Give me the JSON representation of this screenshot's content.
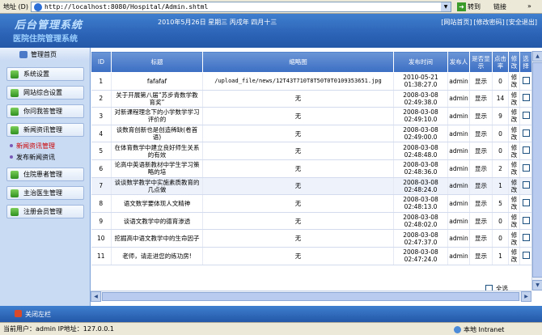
{
  "browser": {
    "address_label": "地址 (D)",
    "url": "http://localhost:8080/Hospital/Admin.shtml",
    "go_label": "转到",
    "links_label": "链接"
  },
  "header": {
    "logo": "后台管理系统",
    "system_name": "医院住院管理系统",
    "date": "2010年5月26日 星期三 丙戌年 四月十三",
    "links": [
      "[网站首页]",
      "[修改密码]",
      "[安全退出]"
    ]
  },
  "sidebar": {
    "title": "管理首页",
    "items": [
      {
        "label": "系统设置"
      },
      {
        "label": "网站综合设置"
      },
      {
        "label": "你问我答管理"
      },
      {
        "label": "新闻资讯管理"
      }
    ],
    "subitems": [
      {
        "label": "新闻资讯管理",
        "active": true
      },
      {
        "label": "发布新闻资讯",
        "active": false
      }
    ],
    "items2": [
      {
        "label": "住院患者管理"
      },
      {
        "label": "主治医生管理"
      },
      {
        "label": "注册会员管理"
      }
    ]
  },
  "table": {
    "headers": [
      "ID",
      "标题",
      "缩略图",
      "发布时间",
      "发布人",
      "是否显示",
      "点击率",
      "修改",
      "选择"
    ],
    "rows": [
      {
        "id": "1",
        "title": "fafafaf",
        "thumb": "/upload_file/news/12T43T710T8T50T0T0109353651.jpg",
        "time": "2010-05-21 01:38:27.0",
        "author": "admin",
        "show": "显示",
        "clicks": "0",
        "edit": "修改"
      },
      {
        "id": "2",
        "title": "关于开展第八届“苏步青数学教育奖”",
        "thumb": "无",
        "time": "2008-03-08 02:49:38.0",
        "author": "admin",
        "show": "显示",
        "clicks": "14",
        "edit": "修改"
      },
      {
        "id": "3",
        "title": "对新课程理念下的小学数学学习评价的",
        "thumb": "无",
        "time": "2008-03-08 02:49:10.0",
        "author": "admin",
        "show": "显示",
        "clicks": "9",
        "edit": "修改"
      },
      {
        "id": "4",
        "title": "谈数育创新也是创造稀缺(卷首语)",
        "thumb": "无",
        "time": "2008-03-08 02:49:00.0",
        "author": "admin",
        "show": "显示",
        "clicks": "0",
        "edit": "修改"
      },
      {
        "id": "5",
        "title": "在体育数学中建立良好师生关系的有效",
        "thumb": "无",
        "time": "2008-03-08 02:48:48.0",
        "author": "admin",
        "show": "显示",
        "clicks": "0",
        "edit": "修改"
      },
      {
        "id": "6",
        "title": "论高中英语新教材中学生学习策略的培",
        "thumb": "无",
        "time": "2008-03-08 02:48:36.0",
        "author": "admin",
        "show": "显示",
        "clicks": "2",
        "edit": "修改"
      },
      {
        "id": "7",
        "title": "谈谈数学教学中实施素质教育的几点做",
        "thumb": "无",
        "time": "2008-03-08 02:48:24.0",
        "author": "admin",
        "show": "显示",
        "clicks": "1",
        "edit": "修改"
      },
      {
        "id": "8",
        "title": "语文数学要体现人文精神",
        "thumb": "无",
        "time": "2008-03-08 02:48:13.0",
        "author": "admin",
        "show": "显示",
        "clicks": "5",
        "edit": "修改"
      },
      {
        "id": "9",
        "title": "谈语文教学中的德育渗透",
        "thumb": "无",
        "time": "2008-03-08 02:48:02.0",
        "author": "admin",
        "show": "显示",
        "clicks": "0",
        "edit": "修改"
      },
      {
        "id": "10",
        "title": "挖掘高中语文教学中的生命因子",
        "thumb": "无",
        "time": "2008-03-08 02:47:37.0",
        "author": "admin",
        "show": "显示",
        "clicks": "0",
        "edit": "修改"
      },
      {
        "id": "11",
        "title": "老师，请走进您的练功房!",
        "thumb": "无",
        "time": "2008-03-08 02:47:24.0",
        "author": "admin",
        "show": "显示",
        "clicks": "1",
        "edit": "修改"
      }
    ],
    "select_all": "全选"
  },
  "footer": {
    "close_sidebar": "关闭左栏",
    "status_user": "当前用户：admin  IP地址：127.0.0.1",
    "status_zone": "本地 Intranet"
  }
}
